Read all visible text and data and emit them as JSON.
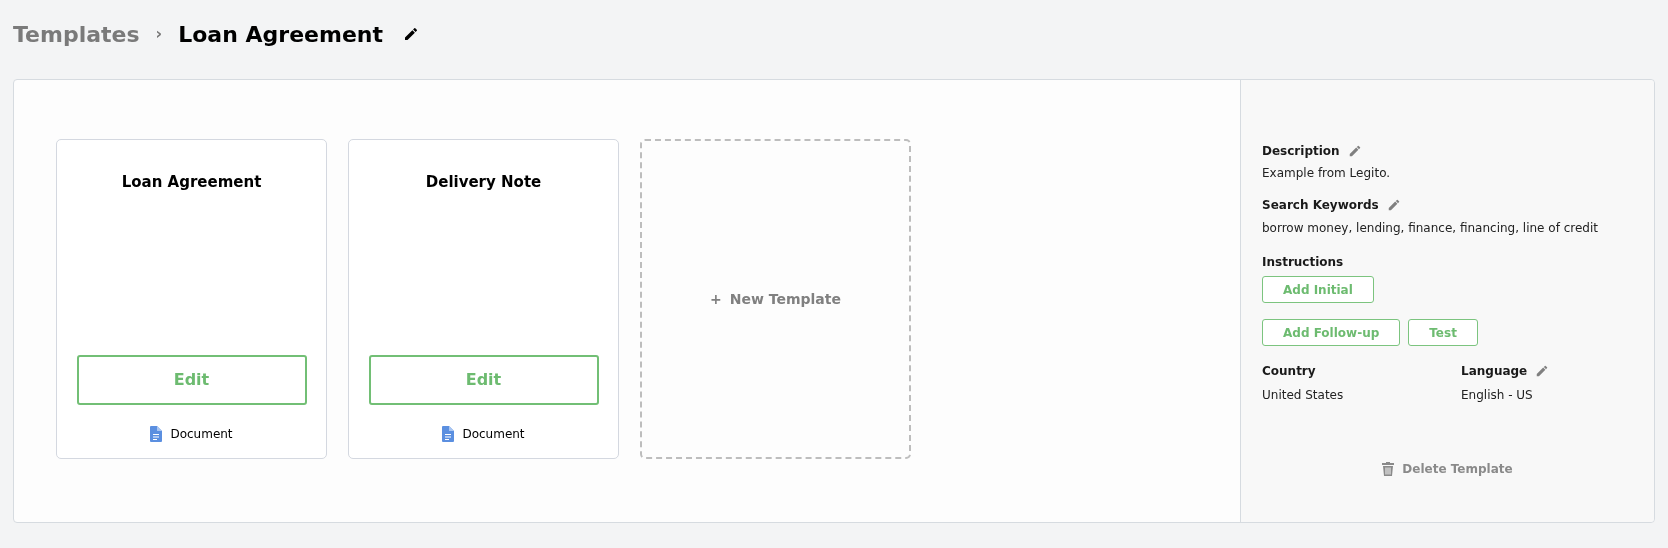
{
  "breadcrumb": {
    "parent": "Templates",
    "separator": "›",
    "current": "Loan Agreement"
  },
  "templates": [
    {
      "title": "Loan Agreement",
      "button": "Edit",
      "type": "Document"
    },
    {
      "title": "Delivery Note",
      "button": "Edit",
      "type": "Document"
    }
  ],
  "new_template": {
    "icon": "+",
    "label": "New Template"
  },
  "details": {
    "description": {
      "label": "Description",
      "value": "Example from Legito."
    },
    "keywords": {
      "label": "Search Keywords",
      "value": "borrow money, lending, finance, financing, line of credit"
    },
    "instructions": {
      "label": "Instructions",
      "buttons": [
        "Add Initial",
        "Add Follow-up",
        "Test"
      ]
    },
    "country": {
      "label": "Country",
      "value": "United States"
    },
    "language": {
      "label": "Language",
      "value": "English - US"
    },
    "delete": "Delete Template"
  }
}
